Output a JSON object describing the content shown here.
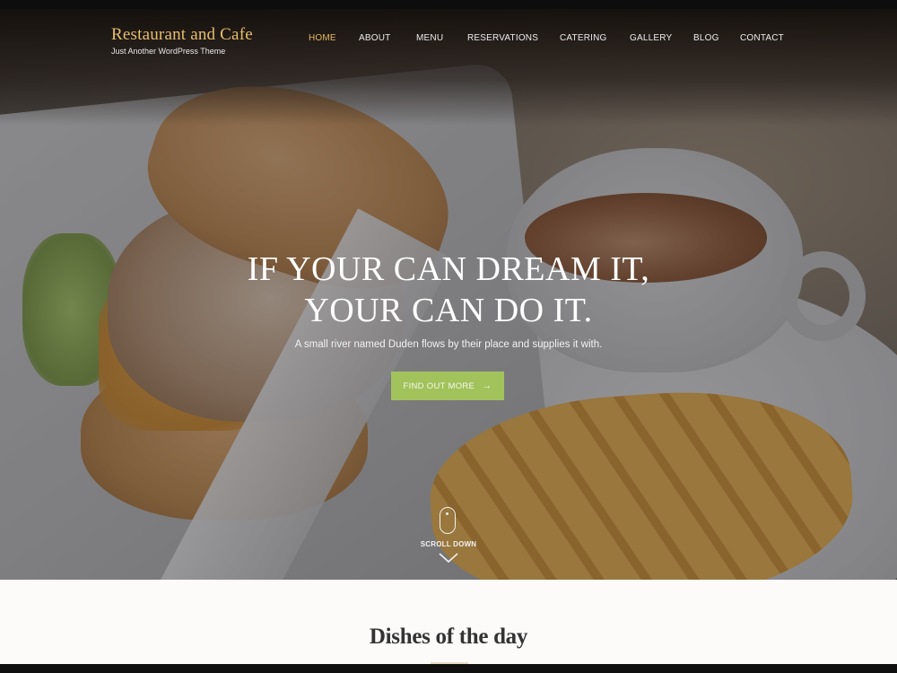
{
  "site": {
    "title": "Restaurant and Cafe",
    "tagline": "Just Another WordPress Theme"
  },
  "nav": {
    "items": [
      {
        "label": "HOME",
        "active": true
      },
      {
        "label": "ABOUT",
        "active": false
      },
      {
        "label": "MENU",
        "active": false
      },
      {
        "label": "RESERVATIONS",
        "active": false
      },
      {
        "label": "CATERING",
        "active": false
      },
      {
        "label": "GALLERY",
        "active": false
      },
      {
        "label": "BLOG",
        "active": false
      },
      {
        "label": "CONTACT",
        "active": false
      }
    ]
  },
  "hero": {
    "title_line1": "IF YOUR CAN DREAM IT,",
    "title_line2": "YOUR CAN DO IT.",
    "subtitle": "A small river named Duden flows by their place and supplies it with.",
    "cta_label": "FIND OUT MORE",
    "cta_icon": "arrow-right-icon",
    "scroll_label": "SCROLL DOWN",
    "scroll_icons": [
      "mouse-icon",
      "chevron-down-icon"
    ]
  },
  "section": {
    "title": "Dishes of the day"
  },
  "colors": {
    "brand_gold": "#e6bf6c",
    "nav_active": "#e3b862",
    "cta_green": "#a2c25c",
    "section_bg": "#fdfbf9"
  }
}
